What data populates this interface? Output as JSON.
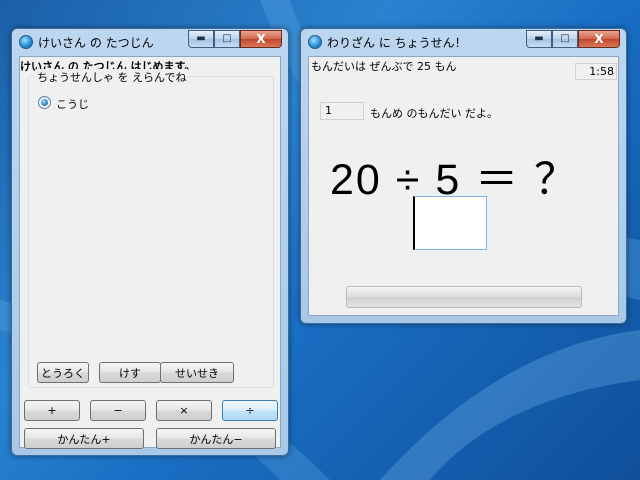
{
  "desktop": {
    "background_color": "#1f6fc0"
  },
  "window_left": {
    "title": "けいさん の たつじん",
    "header": "けいさん の たつじん はじめます。",
    "group_title": "ちょうせんしゃ を えらんでね",
    "challengers": [
      {
        "label": "こうじ",
        "selected": true
      }
    ],
    "buttons": {
      "register": "とうろく",
      "delete": "けす",
      "grades": "せいせき"
    },
    "ops": [
      "+",
      "−",
      "×",
      "÷"
    ],
    "selected_op": "÷",
    "easy_plus": "かんたん+",
    "easy_minus": "かんたん−"
  },
  "window_right": {
    "title": "わりざん に ちょうせん！",
    "total_text": "もんだいは ぜんぶで 25 もん",
    "timer": "1:58",
    "current_number": "1",
    "current_suffix": "もんめ のもんだい だよ。",
    "question": "20 ÷ 5 ＝ ？",
    "answer_value": "",
    "progress_percent": 0
  },
  "window_controls": {
    "minimize": "▬",
    "maximize": "□",
    "close": "X"
  }
}
